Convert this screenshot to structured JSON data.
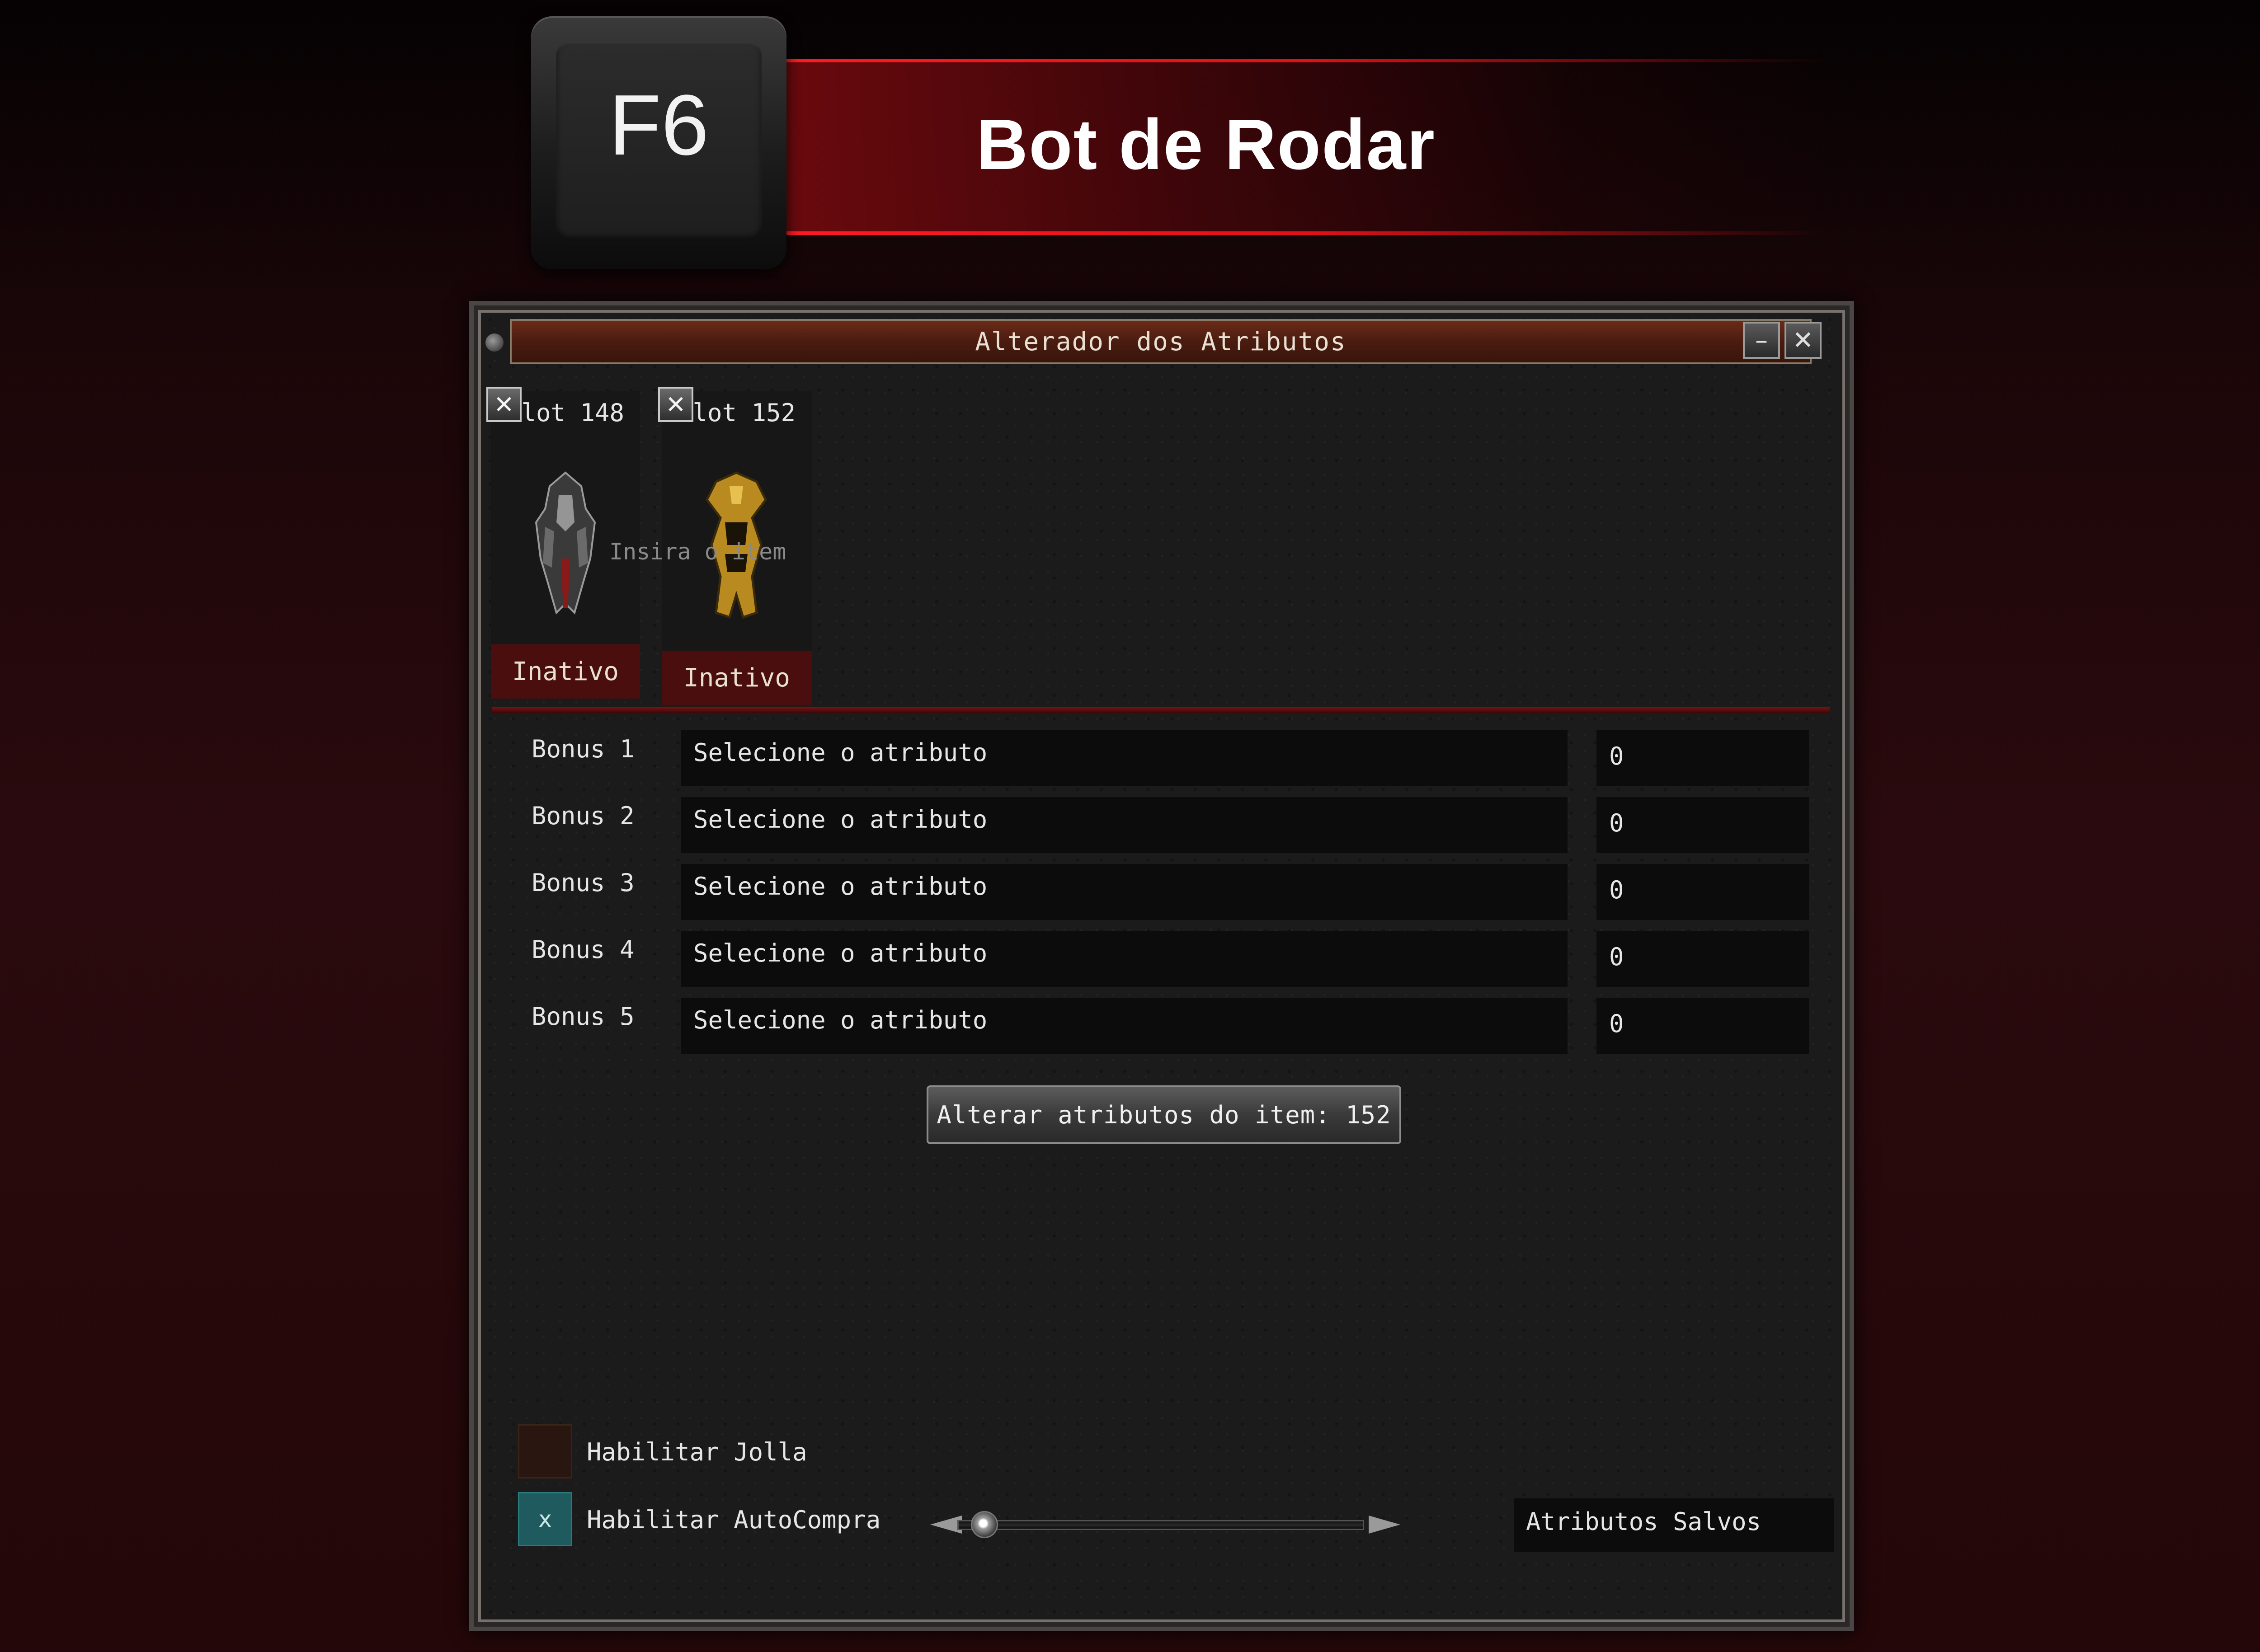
{
  "header": {
    "key_label": "F6",
    "title": "Bot de Rodar"
  },
  "window": {
    "title": "Alterador dos Atributos",
    "minimize_label": "–",
    "close_label": "✕"
  },
  "slots": [
    {
      "label": "Slot 148",
      "status": "Inativo",
      "item_icon": "dark-armor-icon"
    },
    {
      "label": "Slot 152",
      "status": "Inativo",
      "item_icon": "gold-armor-icon"
    }
  ],
  "slot_remove_label": "✕",
  "insert_hint": "Insira o item",
  "bonuses": [
    {
      "label": "Bonus 1",
      "attribute": "Selecione o atributo",
      "value": "0"
    },
    {
      "label": "Bonus 2",
      "attribute": "Selecione o atributo",
      "value": "0"
    },
    {
      "label": "Bonus 3",
      "attribute": "Selecione o atributo",
      "value": "0"
    },
    {
      "label": "Bonus 4",
      "attribute": "Selecione o atributo",
      "value": "0"
    },
    {
      "label": "Bonus 5",
      "attribute": "Selecione o atributo",
      "value": "0"
    }
  ],
  "apply_button": "Alterar atributos do item: 152",
  "options": {
    "jolla": {
      "label": "Habilitar Jolla",
      "checked": false
    },
    "autocompra": {
      "label": "Habilitar AutoCompra",
      "checked": true,
      "mark": "x"
    }
  },
  "saved_label": "Atributos Salvos",
  "colors": {
    "accent_red": "#e11018",
    "status_bg": "#4a0e0e",
    "checkbox_on": "#1e5a5e",
    "checkbox_off": "#2a1610"
  }
}
